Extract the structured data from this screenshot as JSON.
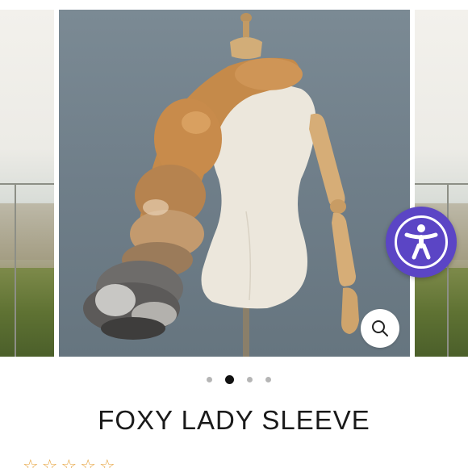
{
  "product": {
    "title": "FOXY LADY SLEEVE",
    "rating": {
      "stars": 5,
      "reviews_text": "",
      "star_color": "#e6a23c"
    }
  },
  "gallery": {
    "slide_count": 4,
    "active_index": 1,
    "zoom_icon": "magnifier-icon",
    "accent_color": "#5b45c5"
  },
  "accessibility": {
    "icon": "accessibility-person-icon"
  }
}
